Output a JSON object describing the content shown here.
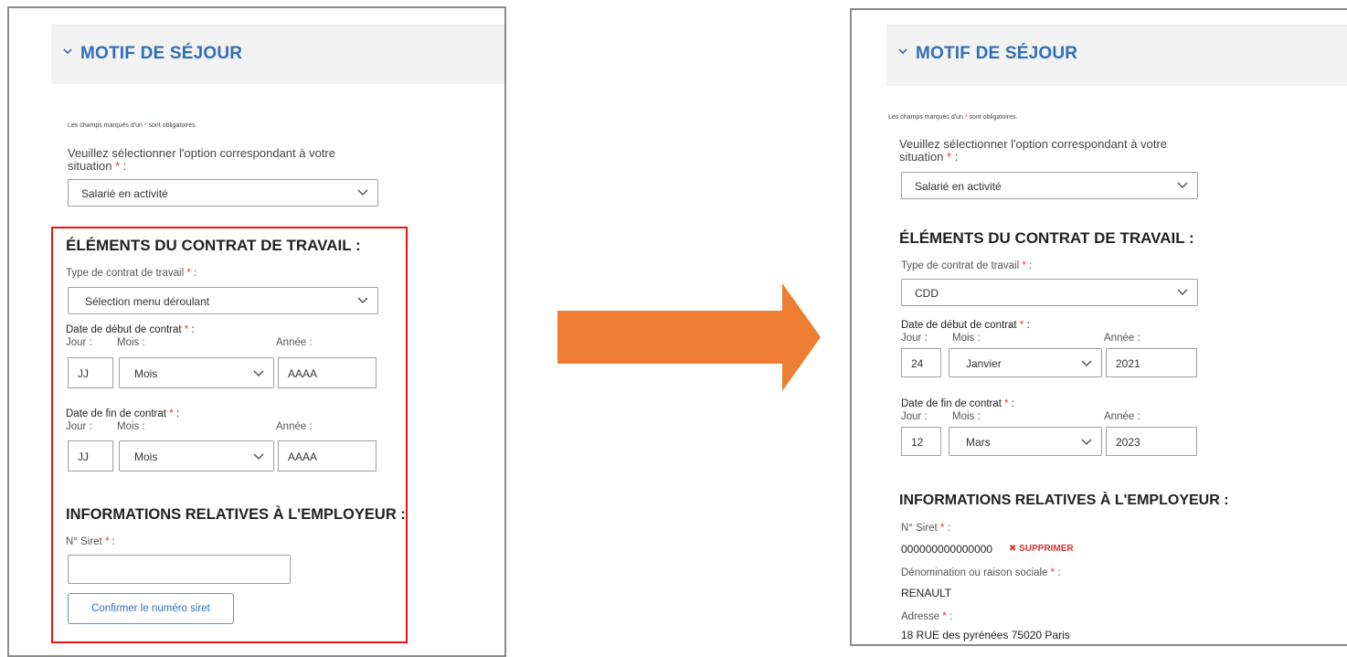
{
  "colors": {
    "accent": "#2f6fb5",
    "required": "#e03a3a",
    "highlight_frame": "#ee1111",
    "arrow": "#ed7d31"
  },
  "before": {
    "section_title": "MOTIF DE SÉJOUR",
    "required_note_pre": "Les champs marqués d'un",
    "required_note_post": "sont obligatoires.",
    "situation_prompt": "Veuillez sélectionner l'option correspondant à votre situation",
    "situation_value": "Salarié en activité",
    "contract_heading": "ÉLÉMENTS DU CONTRAT DE TRAVAIL :",
    "contract_type_label": "Type de contrat de travail",
    "contract_type_value": "Sélection menu déroulant",
    "start_label": "Date de début de contrat",
    "end_label": "Date de fin de contrat",
    "day_label": "Jour :",
    "month_label": "Mois :",
    "year_label": "Année :",
    "start_day": "JJ",
    "start_month": "Mois",
    "start_year": "AAAA",
    "end_day": "JJ",
    "end_month": "Mois",
    "end_year": "AAAA",
    "employer_heading": "INFORMATIONS RELATIVES À L'EMPLOYEUR :",
    "siret_label": "N° Siret",
    "siret_value": "",
    "confirm_button": "Confirmer le numéro siret"
  },
  "after": {
    "section_title": "MOTIF DE SÉJOUR",
    "required_note_pre": "Les champs marqués d'un",
    "required_note_post": "sont obligatoires.",
    "situation_prompt": "Veuillez sélectionner l'option correspondant à votre situation",
    "situation_value": "Salarié en activité",
    "contract_heading": "ÉLÉMENTS DU CONTRAT DE TRAVAIL :",
    "contract_type_label": "Type de contrat de travail",
    "contract_type_value": "CDD",
    "start_label": "Date de début de contrat",
    "end_label": "Date de fin de contrat",
    "day_label": "Jour :",
    "month_label": "Mois :",
    "year_label": "Année :",
    "start_day": "24",
    "start_month": "Janvier",
    "start_year": "2021",
    "end_day": "12",
    "end_month": "Mars",
    "end_year": "2023",
    "employer_heading": "INFORMATIONS RELATIVES À L'EMPLOYEUR :",
    "siret_label": "N° Siret",
    "siret_value": "000000000000000",
    "delete_label": "SUPPRIMER",
    "company_label": "Dénomination ou raison sociale",
    "company_value": "RENAULT",
    "address_label": "Adresse",
    "address_value": "18 RUE des pyrénées 75020 Paris"
  },
  "required_mark": "*",
  "colon": " :"
}
